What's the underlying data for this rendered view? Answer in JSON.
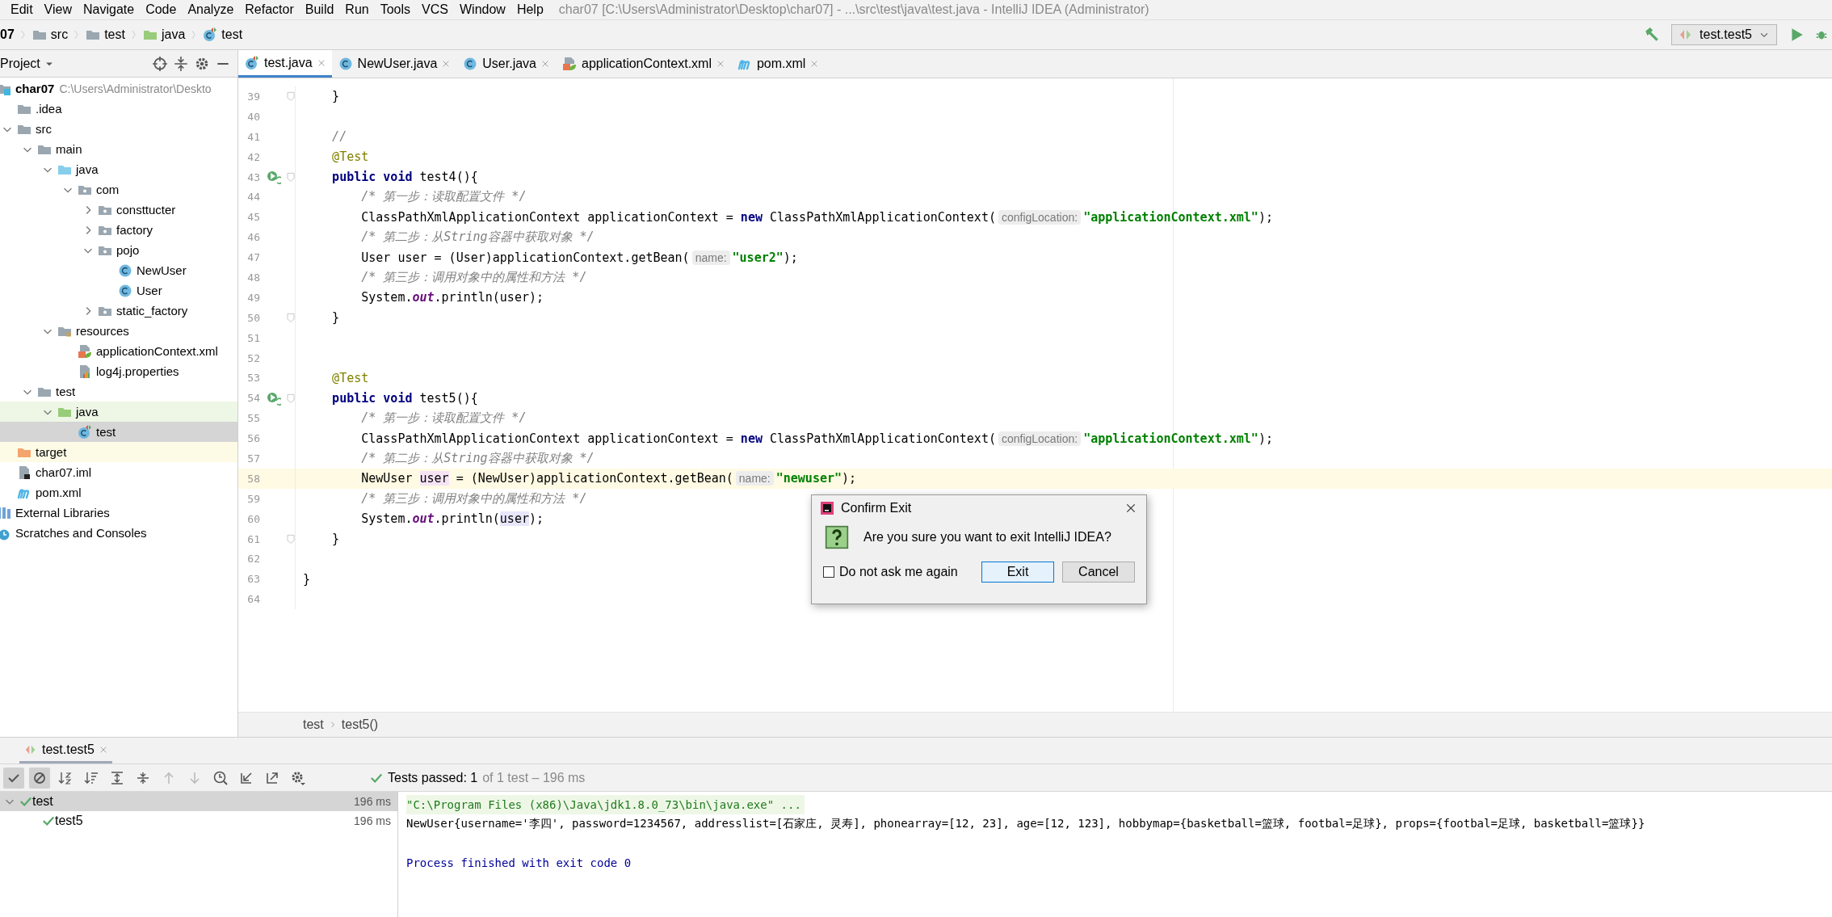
{
  "menu": [
    "Edit",
    "View",
    "Navigate",
    "Code",
    "Analyze",
    "Refactor",
    "Build",
    "Run",
    "Tools",
    "VCS",
    "Window",
    "Help"
  ],
  "window_title": "char07 [C:\\Users\\Administrator\\Desktop\\char07] - ...\\src\\test\\java\\test.java - IntelliJ IDEA (Administrator)",
  "nav_bar": [
    {
      "label": "07",
      "kind": "module"
    },
    {
      "label": "src",
      "kind": "folder"
    },
    {
      "label": "test",
      "kind": "folder"
    },
    {
      "label": "java",
      "kind": "test_folder"
    },
    {
      "label": "test",
      "kind": "test_class"
    }
  ],
  "run_config": {
    "label": "test.test5"
  },
  "project_panel": {
    "title": "Project",
    "tree": [
      {
        "label": "char07",
        "path": "C:\\Users\\Administrator\\Deskto",
        "kind": "module",
        "selected": false,
        "children": [
          {
            "label": ".idea",
            "kind": "folder",
            "selected": false
          },
          {
            "label": "src",
            "kind": "folder",
            "expanded": true,
            "selected": false,
            "children": [
              {
                "label": "main",
                "kind": "folder",
                "expanded": true,
                "selected": false,
                "children": [
                  {
                    "label": "java",
                    "kind": "source_folder",
                    "expanded": true,
                    "selected": false,
                    "children": [
                      {
                        "label": "com",
                        "kind": "package",
                        "expanded": true,
                        "selected": false,
                        "children": [
                          {
                            "label": "consttucter",
                            "kind": "package",
                            "expanded": false,
                            "selected": false
                          },
                          {
                            "label": "factory",
                            "kind": "package",
                            "expanded": false,
                            "selected": false
                          },
                          {
                            "label": "pojo",
                            "kind": "package",
                            "expanded": true,
                            "selected": false,
                            "children": [
                              {
                                "label": "NewUser",
                                "kind": "class",
                                "selected": false
                              },
                              {
                                "label": "User",
                                "kind": "class",
                                "selected": false
                              }
                            ]
                          },
                          {
                            "label": "static_factory",
                            "kind": "package",
                            "expanded": false,
                            "selected": false
                          }
                        ]
                      }
                    ]
                  },
                  {
                    "label": "resources",
                    "kind": "resources",
                    "expanded": true,
                    "selected": false,
                    "children": [
                      {
                        "label": "applicationContext.xml",
                        "kind": "spring_xml",
                        "selected": false
                      },
                      {
                        "label": "log4j.properties",
                        "kind": "properties",
                        "selected": false
                      }
                    ]
                  }
                ]
              },
              {
                "label": "test",
                "kind": "folder",
                "expanded": true,
                "selected": false,
                "children": [
                  {
                    "label": "java",
                    "kind": "test_folder",
                    "expanded": true,
                    "selected": false,
                    "children": [
                      {
                        "label": "test",
                        "kind": "test_class",
                        "selected": true
                      }
                    ]
                  }
                ]
              }
            ]
          },
          {
            "label": "target",
            "kind": "excluded_folder",
            "selected": false
          },
          {
            "label": "char07.iml",
            "kind": "iml",
            "selected": false
          },
          {
            "label": "pom.xml",
            "kind": "maven",
            "selected": false
          }
        ]
      },
      {
        "label": "External Libraries",
        "kind": "libraries",
        "selected": false
      },
      {
        "label": "Scratches and Consoles",
        "kind": "scratches",
        "selected": false
      }
    ]
  },
  "editor_tabs": [
    {
      "label": "test.java",
      "kind": "test_class",
      "selected": true
    },
    {
      "label": "NewUser.java",
      "kind": "class",
      "selected": false
    },
    {
      "label": "User.java",
      "kind": "class",
      "selected": false
    },
    {
      "label": "applicationContext.xml",
      "kind": "spring_xml",
      "selected": false
    },
    {
      "label": "pom.xml",
      "kind": "maven",
      "selected": false
    }
  ],
  "code_lines": [
    {
      "number": "39",
      "fold": true,
      "run": false,
      "current": false,
      "tokens": [
        {
          "text": "    }",
          "kind": "plain"
        }
      ]
    },
    {
      "number": "40",
      "fold": false,
      "run": false,
      "current": false
    },
    {
      "number": "41",
      "fold": false,
      "run": false,
      "current": false,
      "tokens": [
        {
          "text": "    //",
          "kind": "comment"
        }
      ]
    },
    {
      "number": "42",
      "fold": false,
      "run": false,
      "current": false,
      "tokens": [
        {
          "text": "    @Test",
          "kind": "annotation"
        }
      ]
    },
    {
      "number": "43",
      "fold": true,
      "run": true,
      "current": false,
      "tokens": [
        {
          "text": "    public void",
          "kind": "keyword"
        },
        {
          "text": " test4(){",
          "kind": "plain"
        }
      ]
    },
    {
      "number": "44",
      "fold": false,
      "run": false,
      "current": false,
      "tokens": [
        {
          "text": "        /* 第一步：读取配置文件 */",
          "kind": "comment"
        }
      ]
    },
    {
      "number": "45",
      "fold": false,
      "run": false,
      "current": false,
      "tokens": [
        {
          "text": "        ClassPathXmlApplicationContext applicationContext = ",
          "kind": "plain"
        },
        {
          "text": "new",
          "kind": "keyword"
        },
        {
          "text": " ClassPathXmlApplicationContext(",
          "kind": "plain"
        },
        {
          "text": "configLocation:",
          "kind": "hint"
        },
        {
          "text": "\"applicationContext.xml\"",
          "kind": "string"
        },
        {
          "text": ");",
          "kind": "plain"
        }
      ]
    },
    {
      "number": "46",
      "fold": false,
      "run": false,
      "current": false,
      "tokens": [
        {
          "text": "        /* 第二步：从String容器中获取对象 */",
          "kind": "comment"
        }
      ]
    },
    {
      "number": "47",
      "fold": false,
      "run": false,
      "current": false,
      "tokens": [
        {
          "text": "        User user = (User)applicationContext.getBean(",
          "kind": "plain"
        },
        {
          "text": "name:",
          "kind": "hint"
        },
        {
          "text": "\"user2\"",
          "kind": "string"
        },
        {
          "text": ");",
          "kind": "plain"
        }
      ]
    },
    {
      "number": "48",
      "fold": false,
      "run": false,
      "current": false,
      "tokens": [
        {
          "text": "        /* 第三步：调用对象中的属性和方法 */",
          "kind": "comment"
        }
      ]
    },
    {
      "number": "49",
      "fold": false,
      "run": false,
      "current": false,
      "tokens": [
        {
          "text": "        System.",
          "kind": "plain"
        },
        {
          "text": "out",
          "kind": "static_field"
        },
        {
          "text": ".println(user);",
          "kind": "plain"
        }
      ]
    },
    {
      "number": "50",
      "fold": true,
      "run": false,
      "current": false,
      "tokens": [
        {
          "text": "    }",
          "kind": "plain"
        }
      ]
    },
    {
      "number": "51",
      "fold": false,
      "run": false,
      "current": false
    },
    {
      "number": "52",
      "fold": false,
      "run": false,
      "current": false
    },
    {
      "number": "53",
      "fold": false,
      "run": false,
      "current": false,
      "tokens": [
        {
          "text": "    @Test",
          "kind": "annotation"
        }
      ]
    },
    {
      "number": "54",
      "fold": true,
      "run": true,
      "current": false,
      "tokens": [
        {
          "text": "    public void",
          "kind": "keyword"
        },
        {
          "text": " test5(){",
          "kind": "plain"
        }
      ]
    },
    {
      "number": "55",
      "fold": false,
      "run": false,
      "current": false,
      "tokens": [
        {
          "text": "        /* 第一步：读取配置文件 */",
          "kind": "comment"
        }
      ]
    },
    {
      "number": "56",
      "fold": false,
      "run": false,
      "current": false,
      "tokens": [
        {
          "text": "        ClassPathXmlApplicationContext applicationContext = ",
          "kind": "plain"
        },
        {
          "text": "new",
          "kind": "keyword"
        },
        {
          "text": " ClassPathXmlApplicationContext(",
          "kind": "plain"
        },
        {
          "text": "configLocation:",
          "kind": "hint"
        },
        {
          "text": "\"applicationContext.xml\"",
          "kind": "string"
        },
        {
          "text": ");",
          "kind": "plain"
        }
      ]
    },
    {
      "number": "57",
      "fold": false,
      "run": false,
      "current": false,
      "tokens": [
        {
          "text": "        /* 第二步：从String容器中获取对象 */",
          "kind": "comment"
        }
      ]
    },
    {
      "number": "58",
      "fold": false,
      "run": false,
      "current": true,
      "tokens": [
        {
          "text": "        NewUser ",
          "kind": "plain"
        },
        {
          "text": "user",
          "kind": "var_write"
        },
        {
          "text": " = (NewUser)applicationContext.getBean(",
          "kind": "plain"
        },
        {
          "text": "name:",
          "kind": "hint"
        },
        {
          "text": "\"newuser\"",
          "kind": "string"
        },
        {
          "text": ");",
          "kind": "plain"
        }
      ]
    },
    {
      "number": "59",
      "fold": false,
      "run": false,
      "current": false,
      "tokens": [
        {
          "text": "        /* 第三步：调用对象中的属性和方法 */",
          "kind": "comment"
        }
      ]
    },
    {
      "number": "60",
      "fold": false,
      "run": false,
      "current": false,
      "tokens": [
        {
          "text": "        System.",
          "kind": "plain"
        },
        {
          "text": "out",
          "kind": "static_field"
        },
        {
          "text": ".println(",
          "kind": "plain"
        },
        {
          "text": "user",
          "kind": "var_read"
        },
        {
          "text": ");",
          "kind": "plain"
        }
      ]
    },
    {
      "number": "61",
      "fold": true,
      "run": false,
      "current": false,
      "tokens": [
        {
          "text": "    }",
          "kind": "plain"
        }
      ]
    },
    {
      "number": "62",
      "fold": false,
      "run": false,
      "current": false
    },
    {
      "number": "63",
      "fold": false,
      "run": false,
      "current": false,
      "tokens": [
        {
          "text": "}",
          "kind": "plain"
        }
      ]
    },
    {
      "number": "64",
      "fold": false,
      "run": false,
      "current": false
    }
  ],
  "editor_breadcrumb": [
    "test",
    "test5()"
  ],
  "run_panel": {
    "tab": {
      "label": "test.test5",
      "selected": true
    },
    "toolbar": [
      {
        "kind": "show_passed",
        "pressed": true
      },
      {
        "kind": "show_ignored",
        "pressed": true
      },
      {
        "kind": "sort_alpha",
        "pressed": false
      },
      {
        "kind": "sort_duration",
        "pressed": false
      },
      {
        "kind": "expand_all",
        "pressed": false
      },
      {
        "kind": "collapse_all",
        "pressed": false
      },
      {
        "kind": "previous",
        "pressed": false
      },
      {
        "kind": "next",
        "pressed": false
      },
      {
        "kind": "history",
        "pressed": false
      },
      {
        "kind": "import",
        "pressed": false
      },
      {
        "kind": "export",
        "pressed": false
      },
      {
        "kind": "settings",
        "pressed": false
      }
    ],
    "status": {
      "main": "Tests passed: 1",
      "detail": "of 1 test – 196 ms"
    },
    "tests": [
      {
        "name": "test",
        "time": "196 ms",
        "selected": true,
        "expanded": true,
        "children": [
          {
            "name": "test5",
            "time": "196 ms",
            "selected": false
          }
        ]
      }
    ],
    "console": [
      {
        "text": "\"C:\\Program Files (x86)\\Java\\jdk1.8.0_73\\bin\\java.exe\" ...",
        "kind": "command"
      },
      {
        "text": "NewUser{username='李四', password=1234567, addresslist=[石家庄, 灵寿], phonearray=[12, 23], age=[12, 123], hobbymap={basketball=篮球, footbal=足球}, props={footbal=足球, basketball=篮球}}",
        "kind": "output"
      },
      {
        "text": "Process finished with exit code 0",
        "kind": "exit"
      }
    ]
  },
  "dialog": {
    "title": "Confirm Exit",
    "message": "Are you sure you want to exit IntelliJ IDEA?",
    "checkbox": {
      "label": "Do not ask me again",
      "checked": false
    },
    "buttons": [
      {
        "label": "Exit",
        "default": true
      },
      {
        "label": "Cancel",
        "default": false
      }
    ]
  }
}
